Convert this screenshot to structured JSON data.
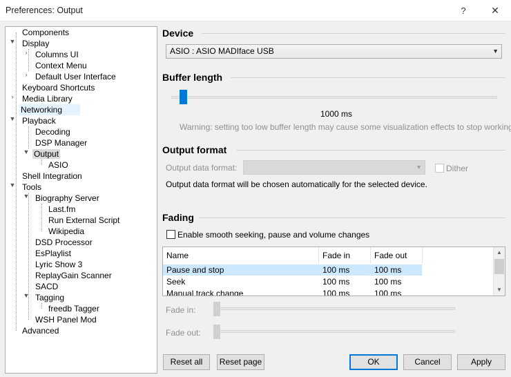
{
  "window": {
    "title": "Preferences: Output",
    "help": "?",
    "close": "✕"
  },
  "tree": [
    {
      "label": "Components"
    },
    {
      "label": "Display"
    },
    {
      "label": "Columns UI"
    },
    {
      "label": "Context Menu"
    },
    {
      "label": "Default User Interface"
    },
    {
      "label": "Keyboard Shortcuts"
    },
    {
      "label": "Media Library"
    },
    {
      "label": "Networking"
    },
    {
      "label": "Playback"
    },
    {
      "label": "Decoding"
    },
    {
      "label": "DSP Manager"
    },
    {
      "label": "Output"
    },
    {
      "label": "ASIO"
    },
    {
      "label": "Shell Integration"
    },
    {
      "label": "Tools"
    },
    {
      "label": "Biography Server"
    },
    {
      "label": "Last.fm"
    },
    {
      "label": "Run External Script"
    },
    {
      "label": "Wikipedia"
    },
    {
      "label": "DSD Processor"
    },
    {
      "label": "EsPlaylist"
    },
    {
      "label": "Lyric Show 3"
    },
    {
      "label": "ReplayGain Scanner"
    },
    {
      "label": "SACD"
    },
    {
      "label": "Tagging"
    },
    {
      "label": "freedb Tagger"
    },
    {
      "label": "WSH Panel Mod"
    },
    {
      "label": "Advanced"
    }
  ],
  "device": {
    "title": "Device",
    "selected": "ASIO : ASIO MADIface USB"
  },
  "buffer": {
    "title": "Buffer length",
    "value_label": "1000 ms",
    "level": 0.03,
    "warning": "Warning: setting too low buffer length may cause some visualization effects to stop working."
  },
  "output_format": {
    "title": "Output format",
    "format_label": "Output data format:",
    "dither_label": "Dither",
    "info": "Output data format will be chosen automatically for the selected device."
  },
  "fading": {
    "title": "Fading",
    "enable_label": "Enable smooth seeking, pause and volume changes",
    "columns": [
      "Name",
      "Fade in",
      "Fade out"
    ],
    "rows": [
      {
        "name": "Pause and stop",
        "fade_in": "100 ms",
        "fade_out": "100 ms"
      },
      {
        "name": "Seek",
        "fade_in": "100 ms",
        "fade_out": "100 ms"
      },
      {
        "name": "Manual track change",
        "fade_in": "100 ms",
        "fade_out": "100 ms"
      }
    ],
    "fade_in_label": "Fade in:",
    "fade_out_label": "Fade out:"
  },
  "buttons": {
    "reset_all": "Reset all",
    "reset_page": "Reset page",
    "ok": "OK",
    "cancel": "Cancel",
    "apply": "Apply"
  },
  "colors": {
    "accent": "#0078d7",
    "selection": "#cce8ff"
  }
}
